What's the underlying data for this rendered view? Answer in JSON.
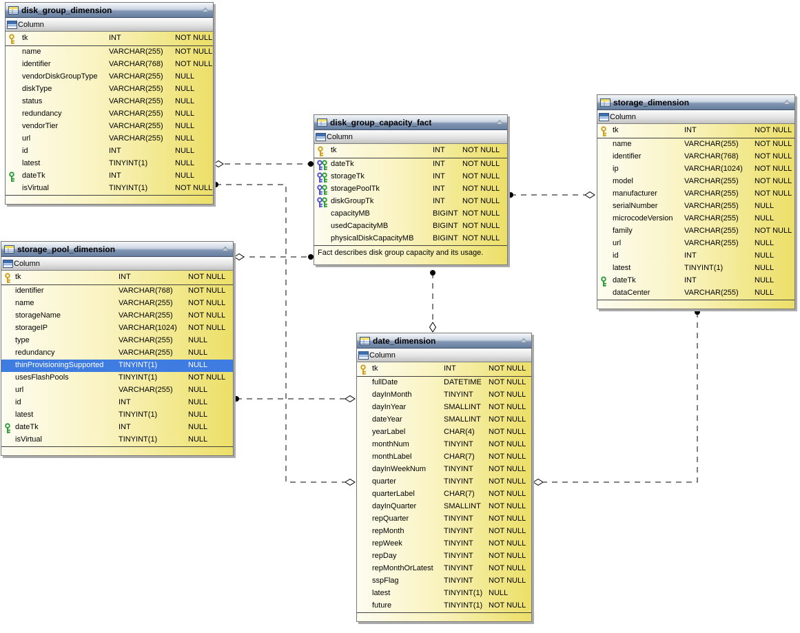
{
  "diagram": {
    "tables": [
      {
        "id": "disk_group_dimension",
        "title": "disk_group_dimension",
        "section_label": "Column",
        "comment": null,
        "columns": [
          {
            "name": "tk",
            "type": "INT",
            "nullable": "NOT NULL",
            "key": "pk"
          },
          {
            "name": "name",
            "type": "VARCHAR(255)",
            "nullable": "NOT NULL"
          },
          {
            "name": "identifier",
            "type": "VARCHAR(768)",
            "nullable": "NOT NULL"
          },
          {
            "name": "vendorDiskGroupType",
            "type": "VARCHAR(255)",
            "nullable": "NULL"
          },
          {
            "name": "diskType",
            "type": "VARCHAR(255)",
            "nullable": "NULL"
          },
          {
            "name": "status",
            "type": "VARCHAR(255)",
            "nullable": "NULL"
          },
          {
            "name": "redundancy",
            "type": "VARCHAR(255)",
            "nullable": "NULL"
          },
          {
            "name": "vendorTier",
            "type": "VARCHAR(255)",
            "nullable": "NULL"
          },
          {
            "name": "url",
            "type": "VARCHAR(255)",
            "nullable": "NULL"
          },
          {
            "name": "id",
            "type": "INT",
            "nullable": "NULL"
          },
          {
            "name": "latest",
            "type": "TINYINT(1)",
            "nullable": "NULL"
          },
          {
            "name": "dateTk",
            "type": "INT",
            "nullable": "NULL",
            "key": "fk"
          },
          {
            "name": "isVirtual",
            "type": "TINYINT(1)",
            "nullable": "NOT NULL"
          }
        ]
      },
      {
        "id": "disk_group_capacity_fact",
        "title": "disk_group_capacity_fact",
        "section_label": "Column",
        "comment": "Fact describes disk group capacity and its usage.",
        "columns": [
          {
            "name": "tk",
            "type": "INT",
            "nullable": "NOT NULL",
            "key": "pk"
          },
          {
            "name": "dateTk",
            "type": "INT",
            "nullable": "NOT NULL",
            "key": "fkc"
          },
          {
            "name": "storageTk",
            "type": "INT",
            "nullable": "NOT NULL",
            "key": "fkc"
          },
          {
            "name": "storagePoolTk",
            "type": "INT",
            "nullable": "NOT NULL",
            "key": "fkc"
          },
          {
            "name": "diskGroupTk",
            "type": "INT",
            "nullable": "NOT NULL",
            "key": "fkc"
          },
          {
            "name": "capacityMB",
            "type": "BIGINT",
            "nullable": "NOT NULL"
          },
          {
            "name": "usedCapacityMB",
            "type": "BIGINT",
            "nullable": "NOT NULL"
          },
          {
            "name": "physicalDiskCapacityMB",
            "type": "BIGINT",
            "nullable": "NOT NULL"
          }
        ]
      },
      {
        "id": "storage_dimension",
        "title": "storage_dimension",
        "section_label": "Column",
        "comment": null,
        "columns": [
          {
            "name": "tk",
            "type": "INT",
            "nullable": "NOT NULL",
            "key": "pk"
          },
          {
            "name": "name",
            "type": "VARCHAR(255)",
            "nullable": "NOT NULL"
          },
          {
            "name": "identifier",
            "type": "VARCHAR(768)",
            "nullable": "NOT NULL"
          },
          {
            "name": "ip",
            "type": "VARCHAR(1024)",
            "nullable": "NOT NULL"
          },
          {
            "name": "model",
            "type": "VARCHAR(255)",
            "nullable": "NOT NULL"
          },
          {
            "name": "manufacturer",
            "type": "VARCHAR(255)",
            "nullable": "NOT NULL"
          },
          {
            "name": "serialNumber",
            "type": "VARCHAR(255)",
            "nullable": "NULL"
          },
          {
            "name": "microcodeVersion",
            "type": "VARCHAR(255)",
            "nullable": "NULL"
          },
          {
            "name": "family",
            "type": "VARCHAR(255)",
            "nullable": "NOT NULL"
          },
          {
            "name": "url",
            "type": "VARCHAR(255)",
            "nullable": "NULL"
          },
          {
            "name": "id",
            "type": "INT",
            "nullable": "NULL"
          },
          {
            "name": "latest",
            "type": "TINYINT(1)",
            "nullable": "NULL"
          },
          {
            "name": "dateTk",
            "type": "INT",
            "nullable": "NULL",
            "key": "fk"
          },
          {
            "name": "dataCenter",
            "type": "VARCHAR(255)",
            "nullable": "NULL"
          }
        ]
      },
      {
        "id": "storage_pool_dimension",
        "title": "storage_pool_dimension",
        "section_label": "Column",
        "comment": null,
        "columns": [
          {
            "name": "tk",
            "type": "INT",
            "nullable": "NOT NULL",
            "key": "pk"
          },
          {
            "name": "identifier",
            "type": "VARCHAR(768)",
            "nullable": "NOT NULL"
          },
          {
            "name": "name",
            "type": "VARCHAR(255)",
            "nullable": "NOT NULL"
          },
          {
            "name": "storageName",
            "type": "VARCHAR(255)",
            "nullable": "NOT NULL"
          },
          {
            "name": "storageIP",
            "type": "VARCHAR(1024)",
            "nullable": "NOT NULL"
          },
          {
            "name": "type",
            "type": "VARCHAR(255)",
            "nullable": "NULL"
          },
          {
            "name": "redundancy",
            "type": "VARCHAR(255)",
            "nullable": "NULL"
          },
          {
            "name": "thinProvisioningSupported",
            "type": "TINYINT(1)",
            "nullable": "NULL",
            "selected": true
          },
          {
            "name": "usesFlashPools",
            "type": "TINYINT(1)",
            "nullable": "NOT NULL"
          },
          {
            "name": "url",
            "type": "VARCHAR(255)",
            "nullable": "NULL"
          },
          {
            "name": "id",
            "type": "INT",
            "nullable": "NULL"
          },
          {
            "name": "latest",
            "type": "TINYINT(1)",
            "nullable": "NULL"
          },
          {
            "name": "dateTk",
            "type": "INT",
            "nullable": "NULL",
            "key": "fk"
          },
          {
            "name": "isVirtual",
            "type": "TINYINT(1)",
            "nullable": "NULL"
          }
        ]
      },
      {
        "id": "date_dimension",
        "title": "date_dimension",
        "section_label": "Column",
        "comment": null,
        "columns": [
          {
            "name": "tk",
            "type": "INT",
            "nullable": "NOT NULL",
            "key": "pk"
          },
          {
            "name": "fullDate",
            "type": "DATETIME",
            "nullable": "NOT NULL"
          },
          {
            "name": "dayInMonth",
            "type": "TINYINT",
            "nullable": "NOT NULL"
          },
          {
            "name": "dayInYear",
            "type": "SMALLINT",
            "nullable": "NOT NULL"
          },
          {
            "name": "dateYear",
            "type": "SMALLINT",
            "nullable": "NOT NULL"
          },
          {
            "name": "yearLabel",
            "type": "CHAR(4)",
            "nullable": "NOT NULL"
          },
          {
            "name": "monthNum",
            "type": "TINYINT",
            "nullable": "NOT NULL"
          },
          {
            "name": "monthLabel",
            "type": "CHAR(7)",
            "nullable": "NOT NULL"
          },
          {
            "name": "dayInWeekNum",
            "type": "TINYINT",
            "nullable": "NOT NULL"
          },
          {
            "name": "quarter",
            "type": "TINYINT",
            "nullable": "NOT NULL"
          },
          {
            "name": "quarterLabel",
            "type": "CHAR(7)",
            "nullable": "NOT NULL"
          },
          {
            "name": "dayInQuarter",
            "type": "SMALLINT",
            "nullable": "NOT NULL"
          },
          {
            "name": "repQuarter",
            "type": "TINYINT",
            "nullable": "NOT NULL"
          },
          {
            "name": "repMonth",
            "type": "TINYINT",
            "nullable": "NOT NULL"
          },
          {
            "name": "repWeek",
            "type": "TINYINT",
            "nullable": "NOT NULL"
          },
          {
            "name": "repDay",
            "type": "TINYINT",
            "nullable": "NOT NULL"
          },
          {
            "name": "repMonthOrLatest",
            "type": "TINYINT",
            "nullable": "NOT NULL"
          },
          {
            "name": "sspFlag",
            "type": "TINYINT",
            "nullable": "NOT NULL"
          },
          {
            "name": "latest",
            "type": "TINYINT(1)",
            "nullable": "NULL"
          },
          {
            "name": "future",
            "type": "TINYINT(1)",
            "nullable": "NOT NULL"
          }
        ]
      }
    ],
    "relationships": [
      {
        "from": "disk_group_dimension",
        "to": "disk_group_capacity_fact"
      },
      {
        "from": "disk_group_dimension",
        "to": "date_dimension"
      },
      {
        "from": "storage_pool_dimension",
        "to": "disk_group_capacity_fact"
      },
      {
        "from": "storage_pool_dimension",
        "to": "date_dimension"
      },
      {
        "from": "disk_group_capacity_fact",
        "to": "date_dimension"
      },
      {
        "from": "disk_group_capacity_fact",
        "to": "storage_dimension"
      },
      {
        "from": "storage_dimension",
        "to": "date_dimension"
      }
    ],
    "colors": {
      "selection": "#3e7ce2",
      "table_body": "#f5edA0",
      "header_blue": "#667e9e",
      "pk_key": "#cf9f1f",
      "fk_key_green": "#2f9e40",
      "fk_key_blue": "#5353d6",
      "line": "#000000"
    }
  }
}
